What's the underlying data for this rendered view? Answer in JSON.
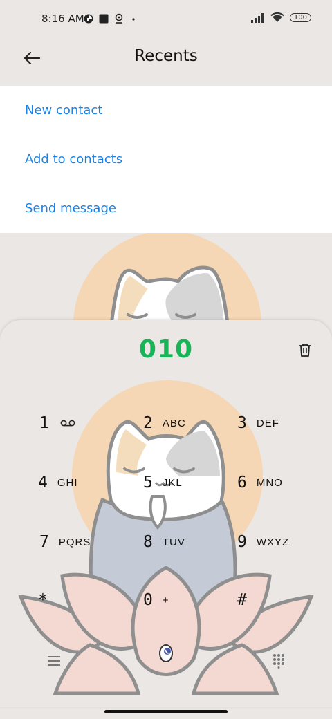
{
  "status_bar": {
    "time": "8:16 AM",
    "battery": "100",
    "icons": [
      "app-notification-icon",
      "stop-icon",
      "location-icon",
      "dot-icon",
      "signal-icon",
      "wifi-icon",
      "battery-icon"
    ]
  },
  "header": {
    "title": "Recents",
    "back_icon": "back-arrow-icon"
  },
  "menu": {
    "items": [
      {
        "label": "New contact"
      },
      {
        "label": "Add to contacts"
      },
      {
        "label": "Send message"
      }
    ]
  },
  "dialer": {
    "number": "010",
    "delete_icon": "trash-icon",
    "keys": [
      {
        "digit": "1",
        "letters": "",
        "icon": "voicemail-icon"
      },
      {
        "digit": "2",
        "letters": "ABC"
      },
      {
        "digit": "3",
        "letters": "DEF"
      },
      {
        "digit": "4",
        "letters": "GHI"
      },
      {
        "digit": "5",
        "letters": "JKL"
      },
      {
        "digit": "6",
        "letters": "MNO"
      },
      {
        "digit": "7",
        "letters": "PQRS"
      },
      {
        "digit": "8",
        "letters": "TUV"
      },
      {
        "digit": "9",
        "letters": "WXYZ"
      },
      {
        "digit": "*",
        "letters": ""
      },
      {
        "digit": "0",
        "letters": "+"
      },
      {
        "digit": "#",
        "letters": ""
      }
    ],
    "bottom": {
      "menu_icon": "hamburger-menu-icon",
      "call_icon": "phone-call-icon",
      "keypad_icon": "dialpad-grid-icon"
    }
  },
  "colors": {
    "accent_link": "#1a82e6",
    "number_green": "#17b557",
    "background": "#ebe7e4",
    "wallpaper_halo": "#f5d7b5",
    "lotus_pink": "#f4d9d2"
  }
}
